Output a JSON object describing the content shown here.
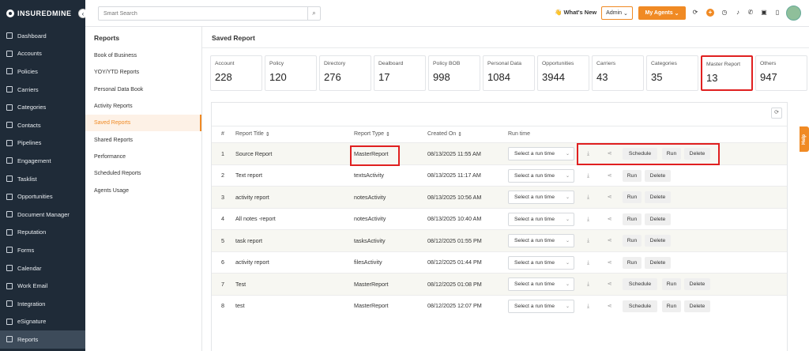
{
  "brand": {
    "logo_text": "INSUREDMINE"
  },
  "sidebar": {
    "items": [
      {
        "label": "Dashboard"
      },
      {
        "label": "Accounts"
      },
      {
        "label": "Policies"
      },
      {
        "label": "Carriers"
      },
      {
        "label": "Categories"
      },
      {
        "label": "Contacts"
      },
      {
        "label": "Pipelines"
      },
      {
        "label": "Engagement"
      },
      {
        "label": "Tasklist"
      },
      {
        "label": "Opportunities"
      },
      {
        "label": "Document Manager"
      },
      {
        "label": "Reputation"
      },
      {
        "label": "Forms"
      },
      {
        "label": "Calendar"
      },
      {
        "label": "Work Email"
      },
      {
        "label": "Integration"
      },
      {
        "label": "eSignature"
      },
      {
        "label": "Reports"
      }
    ],
    "active": "Reports"
  },
  "topbar": {
    "search_placeholder": "Smart Search",
    "whats_new": "What's New",
    "admin_label": "Admin",
    "agents_label": "My Agents"
  },
  "submenu": {
    "title": "Reports",
    "items": [
      {
        "label": "Book of Business"
      },
      {
        "label": "YOY/YTD Reports"
      },
      {
        "label": "Personal Data Book"
      },
      {
        "label": "Activity Reports"
      },
      {
        "label": "Saved Reports"
      },
      {
        "label": "Shared Reports"
      },
      {
        "label": "Performance"
      },
      {
        "label": "Scheduled Reports"
      },
      {
        "label": "Agents Usage"
      }
    ],
    "active": "Saved Reports"
  },
  "main": {
    "title": "Saved Report",
    "cards": [
      {
        "label": "Account",
        "value": "228"
      },
      {
        "label": "Policy",
        "value": "120"
      },
      {
        "label": "Directory",
        "value": "276"
      },
      {
        "label": "Dealboard",
        "value": "17"
      },
      {
        "label": "Policy BOB",
        "value": "998"
      },
      {
        "label": "Personal Data",
        "value": "1084"
      },
      {
        "label": "Opportunities",
        "value": "3944"
      },
      {
        "label": "Carriers",
        "value": "43"
      },
      {
        "label": "Categories",
        "value": "35"
      },
      {
        "label": "Master Report",
        "value": "13"
      },
      {
        "label": "Others",
        "value": "947"
      }
    ],
    "table": {
      "headers": {
        "num": "#",
        "title": "Report Title",
        "type": "Report Type",
        "created": "Created On",
        "run": "Run time"
      },
      "run_placeholder": "Select a run time",
      "schedule_label": "Schedule",
      "run_label": "Run",
      "delete_label": "Delete",
      "rows": [
        {
          "num": "1",
          "title": "Source Report",
          "type": "MasterReport",
          "created": "08/13/2025 11:55 AM",
          "schedule": true
        },
        {
          "num": "2",
          "title": "Text report",
          "type": "textsActivity",
          "created": "08/13/2025 11:17 AM",
          "schedule": false
        },
        {
          "num": "3",
          "title": "activity report",
          "type": "notesActivity",
          "created": "08/13/2025 10:56 AM",
          "schedule": false
        },
        {
          "num": "4",
          "title": "All notes -report",
          "type": "notesActivity",
          "created": "08/13/2025 10:40 AM",
          "schedule": false
        },
        {
          "num": "5",
          "title": "task report",
          "type": "tasksActivity",
          "created": "08/12/2025 01:55 PM",
          "schedule": false
        },
        {
          "num": "6",
          "title": "activity report",
          "type": "filesActivity",
          "created": "08/12/2025 01:44 PM",
          "schedule": false
        },
        {
          "num": "7",
          "title": "Test",
          "type": "MasterReport",
          "created": "08/12/2025 01:08 PM",
          "schedule": true
        },
        {
          "num": "8",
          "title": "test",
          "type": "MasterReport",
          "created": "08/12/2025 12:07 PM",
          "schedule": true
        }
      ]
    }
  },
  "help_tab": "Help",
  "colors": {
    "accent": "#f08a24",
    "sidebar_bg": "#1f2b38",
    "highlight": "#e02020"
  }
}
